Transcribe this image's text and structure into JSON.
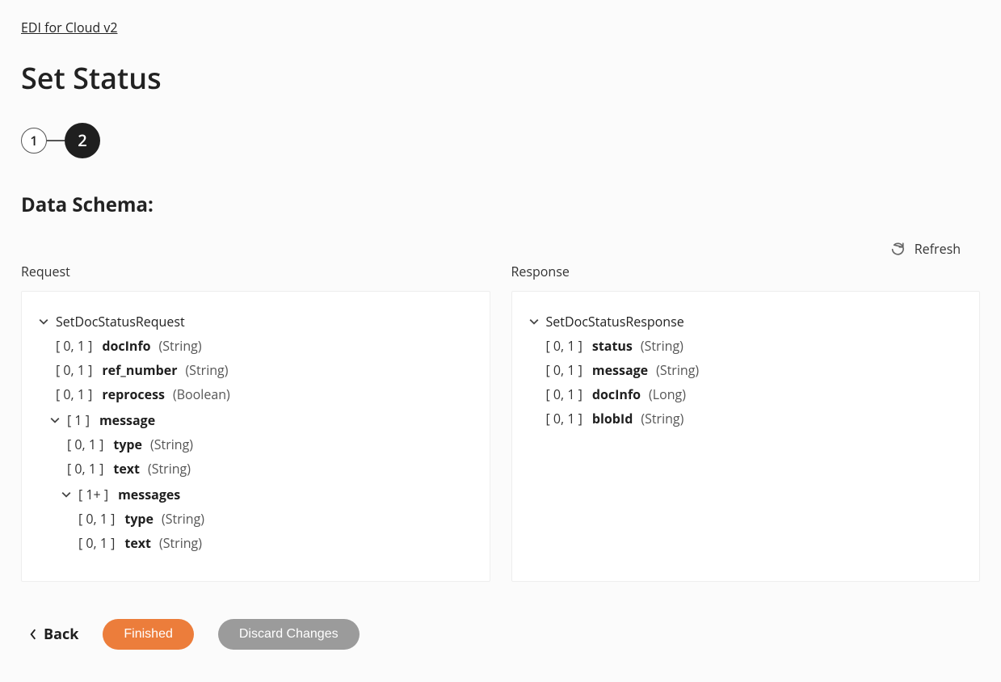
{
  "breadcrumb": {
    "label": "EDI for Cloud v2"
  },
  "title": "Set Status",
  "steps": [
    {
      "label": "1",
      "active": false
    },
    {
      "label": "2",
      "active": true
    }
  ],
  "schema": {
    "heading": "Data Schema:",
    "refresh_label": "Refresh",
    "request": {
      "column_label": "Request",
      "root": {
        "name": "SetDocStatusRequest",
        "fields": [
          {
            "card": "[ 0, 1 ]",
            "name": "docInfo",
            "type": "(String)"
          },
          {
            "card": "[ 0, 1 ]",
            "name": "ref_number",
            "type": "(String)"
          },
          {
            "card": "[ 0, 1 ]",
            "name": "reprocess",
            "type": "(Boolean)"
          }
        ],
        "children": [
          {
            "card": "[ 1 ]",
            "name": "message",
            "fields": [
              {
                "card": "[ 0, 1 ]",
                "name": "type",
                "type": "(String)"
              },
              {
                "card": "[ 0, 1 ]",
                "name": "text",
                "type": "(String)"
              }
            ],
            "children": [
              {
                "card": "[ 1+ ]",
                "name": "messages",
                "fields": [
                  {
                    "card": "[ 0, 1 ]",
                    "name": "type",
                    "type": "(String)"
                  },
                  {
                    "card": "[ 0, 1 ]",
                    "name": "text",
                    "type": "(String)"
                  }
                ]
              }
            ]
          }
        ]
      }
    },
    "response": {
      "column_label": "Response",
      "root": {
        "name": "SetDocStatusResponse",
        "fields": [
          {
            "card": "[ 0, 1 ]",
            "name": "status",
            "type": "(String)"
          },
          {
            "card": "[ 0, 1 ]",
            "name": "message",
            "type": "(String)"
          },
          {
            "card": "[ 0, 1 ]",
            "name": "docInfo",
            "type": "(Long)"
          },
          {
            "card": "[ 0, 1 ]",
            "name": "blobId",
            "type": "(String)"
          }
        ]
      }
    }
  },
  "footer": {
    "back_label": "Back",
    "finished_label": "Finished",
    "discard_label": "Discard Changes"
  }
}
